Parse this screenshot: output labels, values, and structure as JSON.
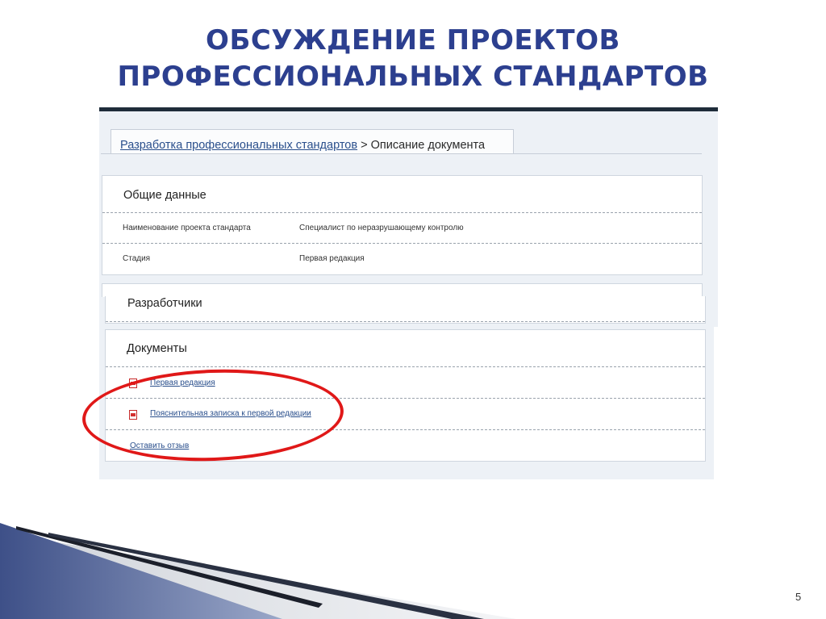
{
  "slide": {
    "title_line1": "ОБСУЖДЕНИЕ ПРОЕКТОВ",
    "title_line2": "ПРОФЕССИОНАЛЬНЫХ СТАНДАРТОВ",
    "page_number": "5"
  },
  "breadcrumb": {
    "link": "Разработка профессиональных стандартов",
    "separator": " > ",
    "current": "Описание документа"
  },
  "general": {
    "header": "Общие данные",
    "rows": [
      {
        "label": "Наименование проекта стандарта",
        "value": "Специалист по неразрушающему контролю"
      },
      {
        "label": "Стадия",
        "value": "Первая редакция"
      }
    ]
  },
  "developers": {
    "header": "Разработчики"
  },
  "documents": {
    "header": "Документы",
    "items": [
      {
        "label": "Первая редакция",
        "icon": "pdf-icon"
      },
      {
        "label": "Пояснительная записка к первой редакции",
        "icon": "pdf-icon"
      }
    ],
    "feedback_link": "Оставить отзыв"
  },
  "colors": {
    "title": "#2c3f8f",
    "link": "#2a4f8c",
    "highlight": "#e01818"
  }
}
